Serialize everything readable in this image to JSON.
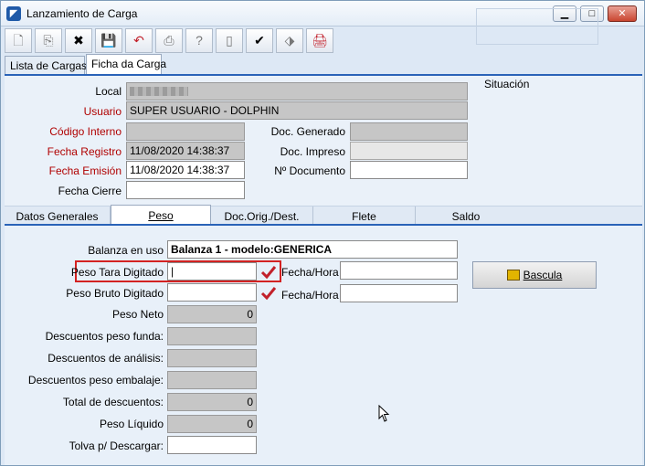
{
  "window": {
    "title": "Lanzamiento de Carga",
    "controls": [
      "minimize",
      "maximize",
      "close"
    ]
  },
  "toolbar": [
    {
      "name": "new-icon",
      "glyph": "🗋"
    },
    {
      "name": "copy-icon",
      "glyph": "⎘"
    },
    {
      "name": "delete-icon",
      "glyph": "✖"
    },
    {
      "name": "save-icon",
      "glyph": "💾"
    },
    {
      "name": "undo-icon",
      "glyph": "↶"
    },
    {
      "name": "print-icon",
      "glyph": "⎙"
    },
    {
      "name": "help-icon",
      "glyph": "?"
    },
    {
      "name": "clipboard-icon",
      "glyph": "▯"
    },
    {
      "name": "confirm-icon",
      "glyph": "✔"
    },
    {
      "name": "eraser-icon",
      "glyph": "⬗"
    },
    {
      "name": "report-icon",
      "glyph": "🖨"
    }
  ],
  "tabs_top": [
    "Lista de Cargas",
    "Ficha da Carga"
  ],
  "header": {
    "local_label": "Local",
    "usuario_label": "Usuario",
    "usuario_value": "SUPER USUARIO - DOLPHIN",
    "codigo_label": "Código Interno",
    "fecha_registro_label": "Fecha Registro",
    "fecha_registro_value": "11/08/2020 14:38:37",
    "fecha_emision_label": "Fecha Emisión",
    "fecha_emision_value": "11/08/2020 14:38:37",
    "fecha_cierre_label": "Fecha Cierre",
    "doc_generado_label": "Doc. Generado",
    "doc_impreso_label": "Doc. Impreso",
    "nro_documento_label": "Nº Documento",
    "situacion_label": "Situación"
  },
  "tabs_detail": [
    "Datos Generales",
    "Peso",
    "Doc.Orig./Dest.",
    "Flete",
    "Saldo"
  ],
  "peso": {
    "balanza_label": "Balanza en uso",
    "balanza_value": "Balanza 1 - modelo:GENERICA",
    "tara_label": "Peso Tara Digitado",
    "tara_value": "|",
    "bruto_label": "Peso Bruto Digitado",
    "fecha_hora_label": "Fecha/Hora",
    "neto_label": "Peso Neto",
    "neto_value": "0",
    "desc_funda_label": "Descuentos peso funda:",
    "desc_analisis_label": "Descuentos de análisis:",
    "desc_embalaje_label": "Descuentos peso embalaje:",
    "total_desc_label": "Total de descuentos:",
    "total_desc_value": "0",
    "liquido_label": "Peso Líquido",
    "liquido_value": "0",
    "tolva_label": "Tolva p/ Descargar:",
    "bascula_label": "Bascula"
  },
  "colors": {
    "label_red": "#b00000",
    "highlight": "#d32222",
    "tab_line": "#2a63b8"
  }
}
